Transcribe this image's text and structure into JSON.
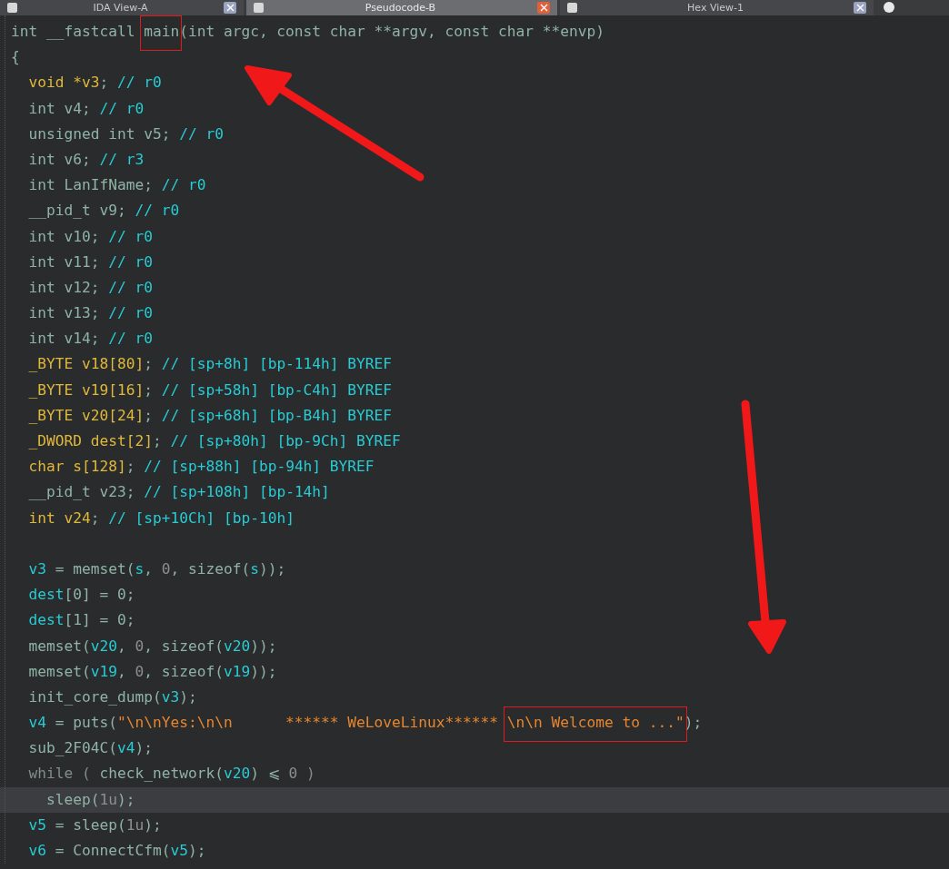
{
  "tabs": [
    {
      "label": "IDA View-A",
      "selected": false
    },
    {
      "label": "Pseudocode-B",
      "selected": true
    },
    {
      "label": "Hex View-1",
      "selected": false
    }
  ],
  "code_lines": [
    {
      "kind": "code",
      "current": false,
      "segments": [
        {
          "kind": "text",
          "text": "int __fastcall "
        },
        {
          "kind": "text",
          "text": "main",
          "boxed": true
        },
        {
          "kind": "text",
          "text": "(int argc, const char **argv, const char **envp)"
        }
      ]
    },
    {
      "kind": "code",
      "current": false,
      "segments": [
        {
          "kind": "text",
          "text": "{"
        }
      ]
    },
    {
      "kind": "code",
      "current": false,
      "segments": [
        {
          "kind": "type",
          "text": "  void *v3"
        },
        {
          "kind": "text",
          "text": ";"
        },
        {
          "kind": "comment",
          "text": " // r0"
        }
      ]
    },
    {
      "kind": "code",
      "current": false,
      "segments": [
        {
          "kind": "text",
          "text": "  int v4;"
        },
        {
          "kind": "comment",
          "text": " // r0"
        }
      ]
    },
    {
      "kind": "code",
      "current": false,
      "segments": [
        {
          "kind": "text",
          "text": "  unsigned int v5;"
        },
        {
          "kind": "comment",
          "text": " // r0"
        }
      ]
    },
    {
      "kind": "code",
      "current": false,
      "segments": [
        {
          "kind": "text",
          "text": "  int v6;"
        },
        {
          "kind": "comment",
          "text": " // r3"
        }
      ]
    },
    {
      "kind": "code",
      "current": false,
      "segments": [
        {
          "kind": "text",
          "text": "  int LanIfName;"
        },
        {
          "kind": "comment",
          "text": " // r0"
        }
      ]
    },
    {
      "kind": "code",
      "current": false,
      "segments": [
        {
          "kind": "text",
          "text": "  __pid_t v9;"
        },
        {
          "kind": "comment",
          "text": " // r0"
        }
      ]
    },
    {
      "kind": "code",
      "current": false,
      "segments": [
        {
          "kind": "text",
          "text": "  int v10;"
        },
        {
          "kind": "comment",
          "text": " // r0"
        }
      ]
    },
    {
      "kind": "code",
      "current": false,
      "segments": [
        {
          "kind": "text",
          "text": "  int v11;"
        },
        {
          "kind": "comment",
          "text": " // r0"
        }
      ]
    },
    {
      "kind": "code",
      "current": false,
      "segments": [
        {
          "kind": "text",
          "text": "  int v12;"
        },
        {
          "kind": "comment",
          "text": " // r0"
        }
      ]
    },
    {
      "kind": "code",
      "current": false,
      "segments": [
        {
          "kind": "text",
          "text": "  int v13;"
        },
        {
          "kind": "comment",
          "text": " // r0"
        }
      ]
    },
    {
      "kind": "code",
      "current": false,
      "segments": [
        {
          "kind": "text",
          "text": "  int v14;"
        },
        {
          "kind": "comment",
          "text": " // r0"
        }
      ]
    },
    {
      "kind": "code",
      "current": false,
      "segments": [
        {
          "kind": "type",
          "text": "  _BYTE v18[80]"
        },
        {
          "kind": "text",
          "text": ";"
        },
        {
          "kind": "comment",
          "text": " // [sp+8h] [bp-114h] BYREF"
        }
      ]
    },
    {
      "kind": "code",
      "current": false,
      "segments": [
        {
          "kind": "type",
          "text": "  _BYTE v19[16]"
        },
        {
          "kind": "text",
          "text": ";"
        },
        {
          "kind": "comment",
          "text": " // [sp+58h] [bp-C4h] BYREF"
        }
      ]
    },
    {
      "kind": "code",
      "current": false,
      "segments": [
        {
          "kind": "type",
          "text": "  _BYTE v20[24]"
        },
        {
          "kind": "text",
          "text": ";"
        },
        {
          "kind": "comment",
          "text": " // [sp+68h] [bp-B4h] BYREF"
        }
      ]
    },
    {
      "kind": "code",
      "current": false,
      "segments": [
        {
          "kind": "type",
          "text": "  _DWORD dest[2]"
        },
        {
          "kind": "text",
          "text": ";"
        },
        {
          "kind": "comment",
          "text": " // [sp+80h] [bp-9Ch] BYREF"
        }
      ]
    },
    {
      "kind": "code",
      "current": false,
      "segments": [
        {
          "kind": "type",
          "text": "  char s[128]"
        },
        {
          "kind": "text",
          "text": ";"
        },
        {
          "kind": "comment",
          "text": " // [sp+88h] [bp-94h] BYREF"
        }
      ]
    },
    {
      "kind": "code",
      "current": false,
      "segments": [
        {
          "kind": "text",
          "text": "  __pid_t v23;"
        },
        {
          "kind": "comment",
          "text": " // [sp+108h] [bp-14h]"
        }
      ]
    },
    {
      "kind": "code",
      "current": false,
      "segments": [
        {
          "kind": "type",
          "text": "  int v24"
        },
        {
          "kind": "text",
          "text": ";"
        },
        {
          "kind": "comment",
          "text": " // [sp+10Ch] [bp-10h]"
        }
      ]
    },
    {
      "kind": "blank"
    },
    {
      "kind": "code",
      "current": false,
      "segments": [
        {
          "kind": "var",
          "text": "  v3"
        },
        {
          "kind": "text",
          "text": " = memset("
        },
        {
          "kind": "var",
          "text": "s"
        },
        {
          "kind": "text",
          "text": ", "
        },
        {
          "kind": "number",
          "text": "0"
        },
        {
          "kind": "text",
          "text": ", sizeof("
        },
        {
          "kind": "var",
          "text": "s"
        },
        {
          "kind": "text",
          "text": "));"
        }
      ]
    },
    {
      "kind": "code",
      "current": false,
      "segments": [
        {
          "kind": "var",
          "text": "  dest"
        },
        {
          "kind": "text",
          "text": "[0] = 0;"
        }
      ]
    },
    {
      "kind": "code",
      "current": false,
      "segments": [
        {
          "kind": "var",
          "text": "  dest"
        },
        {
          "kind": "text",
          "text": "[1] = 0;"
        }
      ]
    },
    {
      "kind": "code",
      "current": false,
      "segments": [
        {
          "kind": "text",
          "text": "  memset("
        },
        {
          "kind": "var",
          "text": "v20"
        },
        {
          "kind": "text",
          "text": ", "
        },
        {
          "kind": "number",
          "text": "0"
        },
        {
          "kind": "text",
          "text": ", sizeof("
        },
        {
          "kind": "var",
          "text": "v20"
        },
        {
          "kind": "text",
          "text": "));"
        }
      ]
    },
    {
      "kind": "code",
      "current": false,
      "segments": [
        {
          "kind": "text",
          "text": "  memset("
        },
        {
          "kind": "var",
          "text": "v19"
        },
        {
          "kind": "text",
          "text": ", "
        },
        {
          "kind": "number",
          "text": "0"
        },
        {
          "kind": "text",
          "text": ", sizeof("
        },
        {
          "kind": "var",
          "text": "v19"
        },
        {
          "kind": "text",
          "text": "));"
        }
      ]
    },
    {
      "kind": "code",
      "current": false,
      "segments": [
        {
          "kind": "text",
          "text": "  init_core_dump("
        },
        {
          "kind": "var",
          "text": "v3"
        },
        {
          "kind": "text",
          "text": ");"
        }
      ]
    },
    {
      "kind": "code",
      "current": false,
      "segments": [
        {
          "kind": "var",
          "text": "  v4"
        },
        {
          "kind": "text",
          "text": " = puts("
        },
        {
          "kind": "string",
          "text": "\"\\n\\nYes:\\n\\n      ****** WeLoveLinux****** "
        },
        {
          "kind": "string",
          "text": "\\n\\n Welcome to ...\"",
          "boxed": true
        },
        {
          "kind": "text",
          "text": ");"
        }
      ]
    },
    {
      "kind": "code",
      "current": false,
      "segments": [
        {
          "kind": "text",
          "text": "  sub_2F04C("
        },
        {
          "kind": "var",
          "text": "v4"
        },
        {
          "kind": "text",
          "text": ");"
        }
      ]
    },
    {
      "kind": "code",
      "current": false,
      "segments": [
        {
          "kind": "keyword",
          "text": "  while ( "
        },
        {
          "kind": "text",
          "text": "check_network("
        },
        {
          "kind": "var",
          "text": "v20"
        },
        {
          "kind": "text",
          "text": ") ⩽ "
        },
        {
          "kind": "number",
          "text": "0"
        },
        {
          "kind": "keyword",
          "text": " )"
        }
      ]
    },
    {
      "kind": "code",
      "current": true,
      "segments": [
        {
          "kind": "text",
          "text": "    sleep("
        },
        {
          "kind": "number",
          "text": "1u"
        },
        {
          "kind": "text",
          "text": ");"
        }
      ]
    },
    {
      "kind": "code",
      "current": false,
      "segments": [
        {
          "kind": "var",
          "text": "  v5"
        },
        {
          "kind": "text",
          "text": " = sleep("
        },
        {
          "kind": "number",
          "text": "1u"
        },
        {
          "kind": "text",
          "text": ");"
        }
      ]
    },
    {
      "kind": "code",
      "current": false,
      "segments": [
        {
          "kind": "var",
          "text": "  v6"
        },
        {
          "kind": "text",
          "text": " = ConnectCfm("
        },
        {
          "kind": "var",
          "text": "v5"
        },
        {
          "kind": "text",
          "text": ");"
        }
      ]
    }
  ]
}
